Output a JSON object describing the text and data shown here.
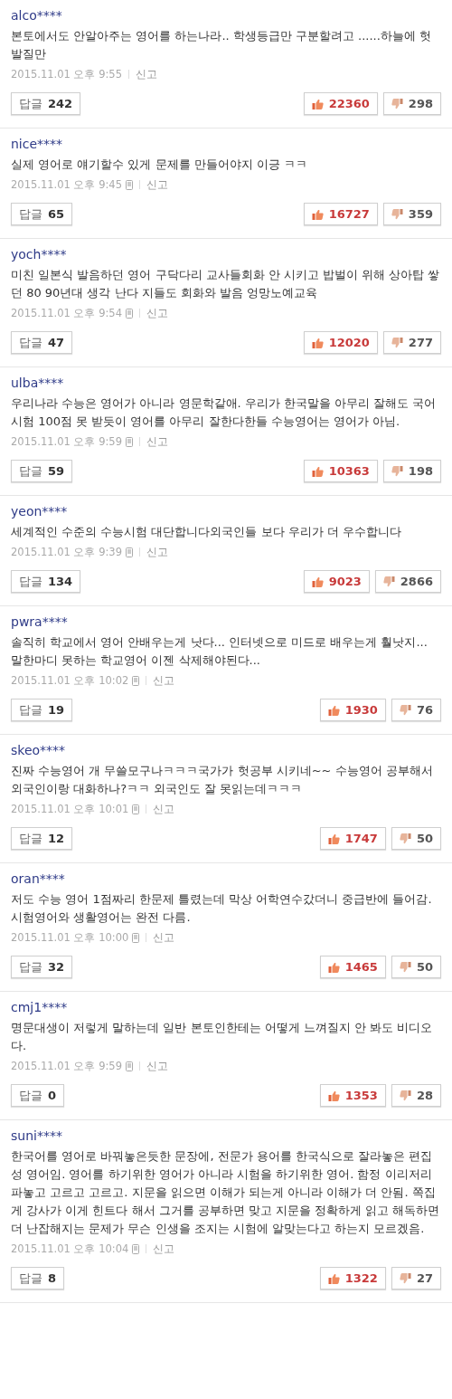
{
  "comments": [
    {
      "user": "alco****",
      "text": "본토에서도 안알아주는 영어를 하는나라.. 학생등급만 구분할려고 ......하늘에 헛발질만",
      "date": "2015.11.01 오후 9:55",
      "mobile": false,
      "report": "신고",
      "reply_label": "답글",
      "replies": "242",
      "likes": "22360",
      "dislikes": "298"
    },
    {
      "user": "nice****",
      "text": "실제 영어로 얘기할수 있게 문제를 만들어야지 이긍 ㅋㅋ",
      "date": "2015.11.01 오후 9:45",
      "mobile": true,
      "report": "신고",
      "reply_label": "답글",
      "replies": "65",
      "likes": "16727",
      "dislikes": "359"
    },
    {
      "user": "yoch****",
      "text": "미친 일본식 발음하던 영어 구닥다리 교사들회화 안 시키고 밥벌이 위해 상아탑 쌓던 80 90년대 생각 난다 지들도 회화와 발음 엉망노예교육",
      "date": "2015.11.01 오후 9:54",
      "mobile": true,
      "report": "신고",
      "reply_label": "답글",
      "replies": "47",
      "likes": "12020",
      "dislikes": "277"
    },
    {
      "user": "ulba****",
      "text": "우리나라 수능은 영어가 아니라 영문학같애. 우리가 한국말을 아무리 잘해도 국어 시험 100점 못 받듯이 영어를 아무리 잘한다한들 수능영어는 영어가 아님.",
      "date": "2015.11.01 오후 9:59",
      "mobile": true,
      "report": "신고",
      "reply_label": "답글",
      "replies": "59",
      "likes": "10363",
      "dislikes": "198"
    },
    {
      "user": "yeon****",
      "text": "세계적인 수준의 수능시험 대단합니다외국인들 보다 우리가 더 우수합니다",
      "date": "2015.11.01 오후 9:39",
      "mobile": true,
      "report": "신고",
      "reply_label": "답글",
      "replies": "134",
      "likes": "9023",
      "dislikes": "2866"
    },
    {
      "user": "pwra****",
      "text": "솔직히 학교에서 영어 안배우는게 낫다... 인터넷으로 미드로 배우는게 훨낫지... 말한마디 못하는 학교영어 이젠 삭제해야된다...",
      "date": "2015.11.01 오후 10:02",
      "mobile": true,
      "report": "신고",
      "reply_label": "답글",
      "replies": "19",
      "likes": "1930",
      "dislikes": "76"
    },
    {
      "user": "skeo****",
      "text": "진짜 수능영어 개 무쓸모구나ㅋㅋㅋ국가가 헛공부 시키네~~ 수능영어 공부해서 외국인이랑 대화하나?ㅋㅋ 외국인도 잘 못읽는데ㅋㅋㅋ",
      "date": "2015.11.01 오후 10:01",
      "mobile": true,
      "report": "신고",
      "reply_label": "답글",
      "replies": "12",
      "likes": "1747",
      "dislikes": "50"
    },
    {
      "user": "oran****",
      "text": "저도 수능 영어 1점짜리 한문제 틀렸는데 막상 어학연수갔더니 중급반에 들어감. 시험영어와 생활영어는 완전 다름.",
      "date": "2015.11.01 오후 10:00",
      "mobile": true,
      "report": "신고",
      "reply_label": "답글",
      "replies": "32",
      "likes": "1465",
      "dislikes": "50"
    },
    {
      "user": "cmj1****",
      "text": "명문대생이 저렇게 말하는데 일반 본토인한테는 어떻게 느껴질지 안 봐도 비디오다.",
      "date": "2015.11.01 오후 9:59",
      "mobile": true,
      "report": "신고",
      "reply_label": "답글",
      "replies": "0",
      "likes": "1353",
      "dislikes": "28"
    },
    {
      "user": "suni****",
      "text": "한국어를 영어로 바꿔놓은듯한 문장에, 전문가 용어를 한국식으로 잘라놓은 편집성 영어임. 영어를 하기위한 영어가 아니라 시험을 하기위한 영어. 함정 이리저리 파놓고 고르고 고르고. 지문을 읽으면 이해가 되는게 아니라 이해가 더 안됨. 쪽집게 강사가 이게 힌트다 해서 그거를 공부하면 맞고 지문을 정확하게 읽고 해독하면 더 난잡해지는 문제가 무슨 인생을 조지는 시험에 알맞는다고 하는지 모르겠음.",
      "date": "2015.11.01 오후 10:04",
      "mobile": true,
      "report": "신고",
      "reply_label": "답글",
      "replies": "8",
      "likes": "1322",
      "dislikes": "27"
    }
  ]
}
